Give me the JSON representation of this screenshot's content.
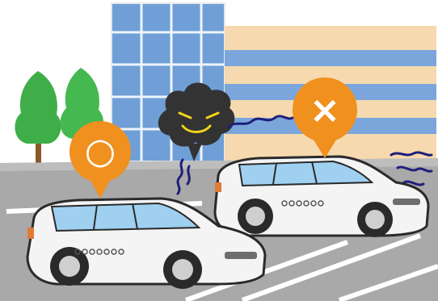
{
  "scene": {
    "good_marker": {
      "symbol": "○",
      "color": "#f0901e",
      "meaning": "ok"
    },
    "bad_marker": {
      "symbol": "×",
      "color": "#f0901e",
      "meaning": "ng"
    },
    "colors": {
      "building_blue": "#6f9fd6",
      "building_beige": "#f6d9ae",
      "asphalt": "#a9a9a9",
      "car_body": "#f4f4f4",
      "tree_green": "#3fae49",
      "cloud": "#333333",
      "cloud_face": "#f2d21a",
      "squiggle": "#1f1f7a"
    }
  }
}
